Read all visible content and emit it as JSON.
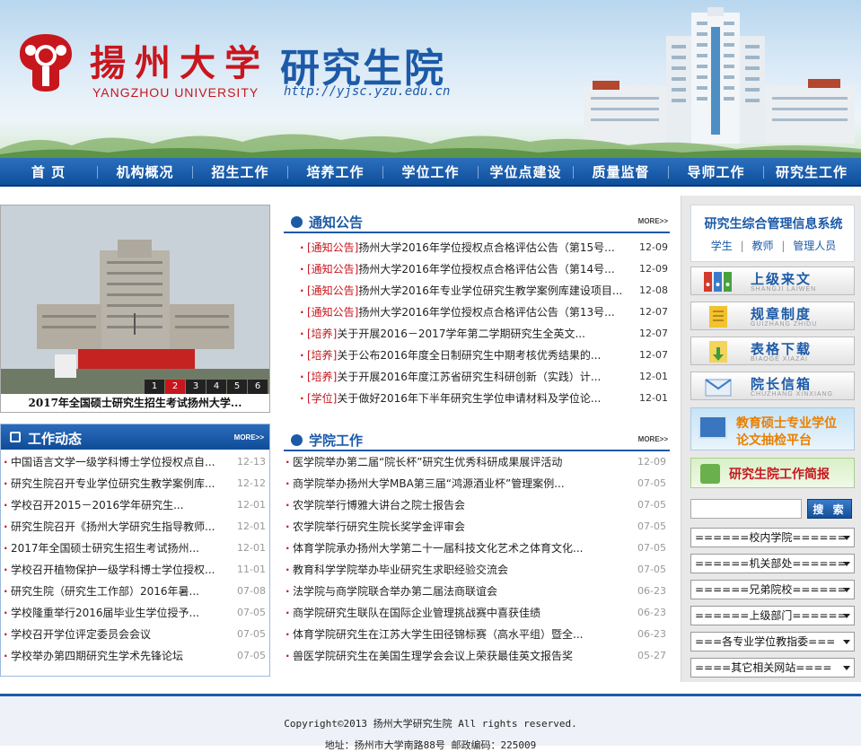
{
  "header": {
    "logo_cn": "揚州大学",
    "logo_en": "YANGZHOU UNIVERSITY",
    "site_title": "研究生院",
    "site_url": "http://yjsc.yzu.edu.cn"
  },
  "nav": {
    "items": [
      "首  页",
      "机构概况",
      "招生工作",
      "培养工作",
      "学位工作",
      "学位点建设",
      "质量监督",
      "导师工作",
      "研究生工作"
    ]
  },
  "slideshow": {
    "numbers": [
      "1",
      "2",
      "3",
      "4",
      "5",
      "6"
    ],
    "active": "2",
    "caption": "2017年全国硕士研究生招生考试扬州大学..."
  },
  "notices": {
    "title": "通知公告",
    "more": "MORE>>",
    "items": [
      {
        "tag": "[通知公告]",
        "text": "扬州大学2016年学位授权点合格评估公告（第15号...",
        "date": "12-09"
      },
      {
        "tag": "[通知公告]",
        "text": "扬州大学2016年学位授权点合格评估公告（第14号...",
        "date": "12-09"
      },
      {
        "tag": "[通知公告]",
        "text": "扬州大学2016年专业学位研究生教学案例库建设项目...",
        "date": "12-08"
      },
      {
        "tag": "[通知公告]",
        "text": "扬州大学2016年学位授权点合格评估公告（第13号...",
        "date": "12-07"
      },
      {
        "tag": "[培养]",
        "text": "关于开展2016－2017学年第二学期研究生全英文...",
        "date": "12-07"
      },
      {
        "tag": "[培养]",
        "text": "关于公布2016年度全日制研究生中期考核优秀结果的...",
        "date": "12-07"
      },
      {
        "tag": "[培养]",
        "text": "关于开展2016年度江苏省研究生科研创新（实践）计...",
        "date": "12-01"
      },
      {
        "tag": "[学位]",
        "text": "关于做好2016年下半年研究生学位申请材料及学位论...",
        "date": "12-01"
      }
    ]
  },
  "work_news": {
    "title": "工作动态",
    "more": "MORE>>",
    "items": [
      {
        "text": "中国语言文学一级学科博士学位授权点自...",
        "date": "12-13"
      },
      {
        "text": "研究生院召开专业学位研究生教学案例库...",
        "date": "12-12"
      },
      {
        "text": "学校召开2015－2016学年研究生...",
        "date": "12-01"
      },
      {
        "text": "研究生院召开《扬州大学研究生指导教师...",
        "date": "12-01"
      },
      {
        "text": "2017年全国硕士研究生招生考试扬州...",
        "date": "12-01"
      },
      {
        "text": "学校召开植物保护一级学科博士学位授权...",
        "date": "11-01"
      },
      {
        "text": "研究生院（研究生工作部）2016年暑...",
        "date": "07-08"
      },
      {
        "text": "学校隆重举行2016届毕业生学位授予...",
        "date": "07-05"
      },
      {
        "text": "学校召开学位评定委员会会议",
        "date": "07-05"
      },
      {
        "text": "学校举办第四期研究生学术先锋论坛",
        "date": "07-05"
      }
    ]
  },
  "college_work": {
    "title": "学院工作",
    "more": "MORE>>",
    "items": [
      {
        "text": "医学院举办第二届“院长杯”研究生优秀科研成果展评活动",
        "date": "12-09"
      },
      {
        "text": "商学院举办扬州大学MBA第三届“鸿源酒业杯”管理案例...",
        "date": "07-05"
      },
      {
        "text": "农学院举行博雅大讲台之院士报告会",
        "date": "07-05"
      },
      {
        "text": "农学院举行研究生院长奖学金评审会",
        "date": "07-05"
      },
      {
        "text": "体育学院承办扬州大学第二十一届科技文化艺术之体育文化...",
        "date": "07-05"
      },
      {
        "text": "教育科学学院举办毕业研究生求职经验交流会",
        "date": "07-05"
      },
      {
        "text": "法学院与商学院联合举办第二届法商联谊会",
        "date": "06-23"
      },
      {
        "text": "商学院研究生联队在国际企业管理挑战赛中喜获佳绩",
        "date": "06-23"
      },
      {
        "text": "体育学院研究生在江苏大学生田径锦标赛（高水平组）暨全...",
        "date": "06-23"
      },
      {
        "text": "兽医学院研究生在美国生理学会会议上荣获最佳英文报告奖",
        "date": "05-27"
      }
    ]
  },
  "sidebar": {
    "gms_title": "研究生综合管理信息系统",
    "gms_links": [
      "学生",
      "教师",
      "管理人员"
    ],
    "gms_sep": "|",
    "quick": [
      {
        "title": "上级来文",
        "pinyin": "SHANGJI LAIWEN",
        "icon": "binders-icon"
      },
      {
        "title": "规章制度",
        "pinyin": "GUIZHANG ZHIDU",
        "icon": "document-icon"
      },
      {
        "title": "表格下载",
        "pinyin": "BIAOGE XIAZAI",
        "icon": "download-icon"
      },
      {
        "title": "院长信箱",
        "pinyin": "CHUZHANG XINXIANG",
        "icon": "mailbox-icon"
      }
    ],
    "banner1": [
      "教育硕士专业学位",
      "论文抽检平台"
    ],
    "banner2": "研究生院工作简报",
    "search_button": "搜 索",
    "search_value": "",
    "selects": [
      "======校内学院======",
      "======机关部处======",
      "======兄弟院校======",
      "======上级部门======",
      "===各专业学位教指委===",
      "====其它相关网站===="
    ]
  },
  "footer": {
    "copyright": "Copyright©2013 扬州大学研究生院 All rights reserved.",
    "address": "地址：扬州市大学南路88号 邮政编码：225009"
  },
  "colors": {
    "primary": "#1c5aa8",
    "accent": "#c8161d",
    "nav": "#0f4f9c"
  }
}
